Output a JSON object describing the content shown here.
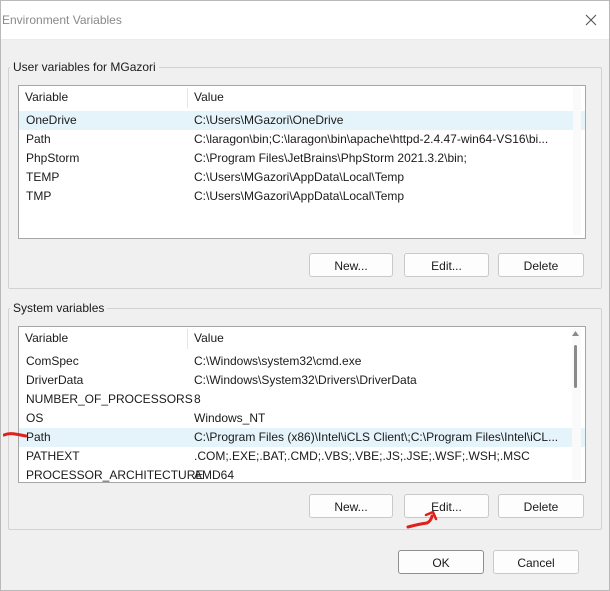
{
  "window": {
    "title": "Environment Variables",
    "close_glyph": "✕"
  },
  "user_vars": {
    "group_label": "User variables for MGazori",
    "headers": {
      "variable": "Variable",
      "value": "Value"
    },
    "rows": [
      {
        "name": "OneDrive",
        "value": "C:\\Users\\MGazori\\OneDrive",
        "selected": true
      },
      {
        "name": "Path",
        "value": "C:\\laragon\\bin;C:\\laragon\\bin\\apache\\httpd-2.4.47-win64-VS16\\bi..."
      },
      {
        "name": "PhpStorm",
        "value": "C:\\Program Files\\JetBrains\\PhpStorm 2021.3.2\\bin;"
      },
      {
        "name": "TEMP",
        "value": "C:\\Users\\MGazori\\AppData\\Local\\Temp"
      },
      {
        "name": "TMP",
        "value": "C:\\Users\\MGazori\\AppData\\Local\\Temp"
      }
    ],
    "buttons": {
      "new": "New...",
      "edit": "Edit...",
      "delete": "Delete"
    }
  },
  "system_vars": {
    "group_label": "System variables",
    "headers": {
      "variable": "Variable",
      "value": "Value"
    },
    "rows": [
      {
        "name": "ComSpec",
        "value": "C:\\Windows\\system32\\cmd.exe"
      },
      {
        "name": "DriverData",
        "value": "C:\\Windows\\System32\\Drivers\\DriverData"
      },
      {
        "name": "NUMBER_OF_PROCESSORS",
        "value": "8"
      },
      {
        "name": "OS",
        "value": "Windows_NT"
      },
      {
        "name": "Path",
        "value": "C:\\Program Files (x86)\\Intel\\iCLS Client\\;C:\\Program Files\\Intel\\iCL...",
        "selected": true
      },
      {
        "name": "PATHEXT",
        "value": ".COM;.EXE;.BAT;.CMD;.VBS;.VBE;.JS;.JSE;.WSF;.WSH;.MSC"
      },
      {
        "name": "PROCESSOR_ARCHITECTURE",
        "value": "AMD64"
      }
    ],
    "buttons": {
      "new": "New...",
      "edit": "Edit...",
      "delete": "Delete"
    }
  },
  "footer": {
    "ok": "OK",
    "cancel": "Cancel"
  },
  "colors": {
    "selection": "#e5f3fb",
    "annotation": "#e0211b"
  },
  "annotations": [
    "red-arrow-to-path-row",
    "red-arrow-to-edit-button"
  ]
}
